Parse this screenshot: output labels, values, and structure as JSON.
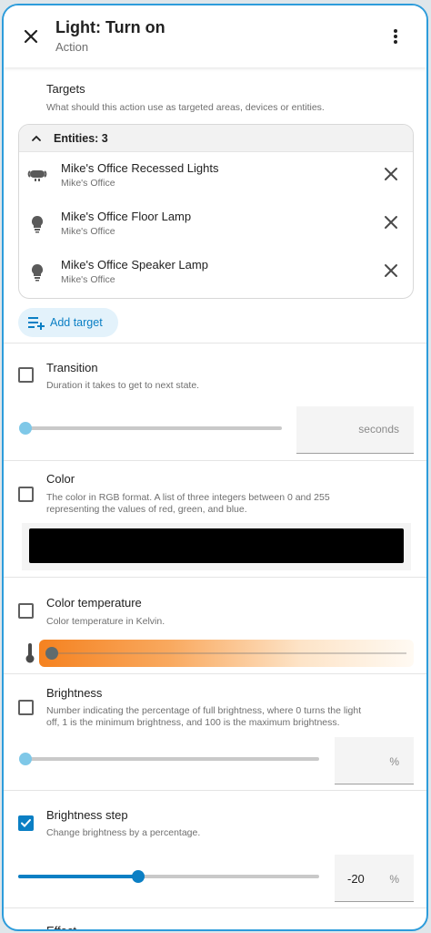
{
  "header": {
    "title": "Light: Turn on",
    "subtitle": "Action"
  },
  "targets": {
    "title": "Targets",
    "description": "What should this action use as targeted areas, devices or entities.",
    "entities_label": "Entities: 3",
    "entities": [
      {
        "name": "Mike's Office Recessed Lights",
        "area": "Mike's Office",
        "icon": "recessed-lights-icon"
      },
      {
        "name": "Mike's Office Floor Lamp",
        "area": "Mike's Office",
        "icon": "bulb-icon"
      },
      {
        "name": "Mike's Office Speaker Lamp",
        "area": "Mike's Office",
        "icon": "bulb-icon"
      }
    ],
    "add_target_label": "Add target"
  },
  "transition": {
    "title": "Transition",
    "description": "Duration it takes to get to next state.",
    "unit": "seconds",
    "checked": false
  },
  "color": {
    "title": "Color",
    "description_line1": "The color in RGB format. A list of three integers between 0 and 255",
    "description_line2": "representing the values of red, green, and blue.",
    "value": "#000000",
    "checked": false
  },
  "color_temperature": {
    "title": "Color temperature",
    "description": "Color temperature in Kelvin.",
    "checked": false
  },
  "brightness": {
    "title": "Brightness",
    "description_line1": "Number indicating the percentage of full brightness, where 0 turns the light",
    "description_line2": "off, 1 is the minimum brightness, and 100 is the maximum brightness.",
    "unit": "%",
    "checked": false
  },
  "brightness_step": {
    "title": "Brightness step",
    "description": "Change brightness by a percentage.",
    "value": "-20",
    "unit": "%",
    "checked": true,
    "slider_fraction": 0.4
  },
  "next_section": {
    "title": "Effect"
  },
  "colors": {
    "accent": "#0b7fc4",
    "frame": "#2d9cdb"
  }
}
